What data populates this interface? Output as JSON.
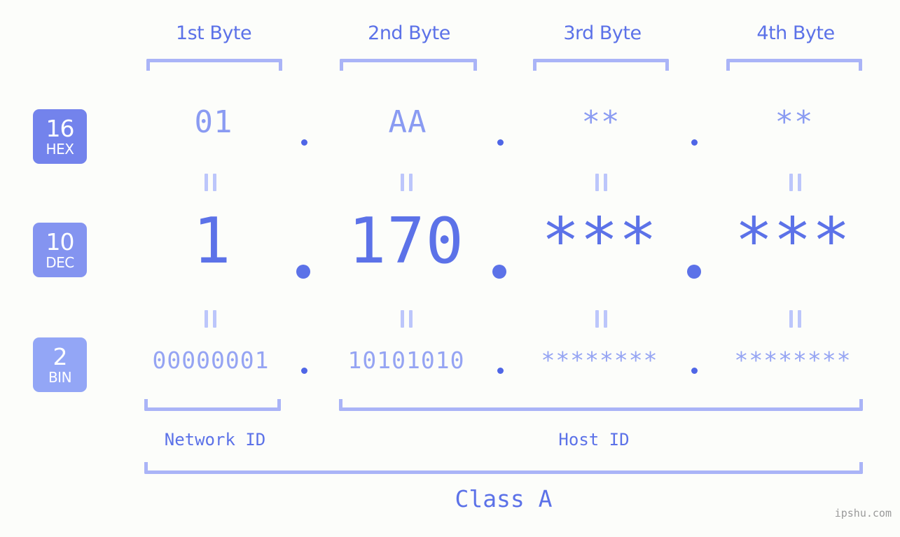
{
  "meta": {
    "background_color": "#fcfdfa",
    "accent_color": "#5c72e8",
    "accent_light_color": "#aab4f7"
  },
  "headers": {
    "byte1": "1st Byte",
    "byte2": "2nd Byte",
    "byte3": "3rd Byte",
    "byte4": "4th Byte"
  },
  "badges": {
    "hex": {
      "number": "16",
      "name": "HEX",
      "color": "#7383ec"
    },
    "dec": {
      "number": "10",
      "name": "DEC",
      "color": "#8494f0"
    },
    "bin": {
      "number": "2",
      "name": "BIN",
      "color": "#93a6f6"
    }
  },
  "rows": {
    "hex": {
      "byte1": "01",
      "byte2": "AA",
      "byte3": "**",
      "byte4": "**"
    },
    "dec": {
      "byte1": "1",
      "byte2": "170",
      "byte3": "***",
      "byte4": "***"
    },
    "bin": {
      "byte1": "00000001",
      "byte2": "10101010",
      "byte3": "********",
      "byte4": "********"
    }
  },
  "separator": ".",
  "equals_glyph": "=",
  "sections": {
    "network_id": "Network ID",
    "host_id": "Host ID",
    "class": "Class A"
  },
  "watermark": "ipshu.com"
}
